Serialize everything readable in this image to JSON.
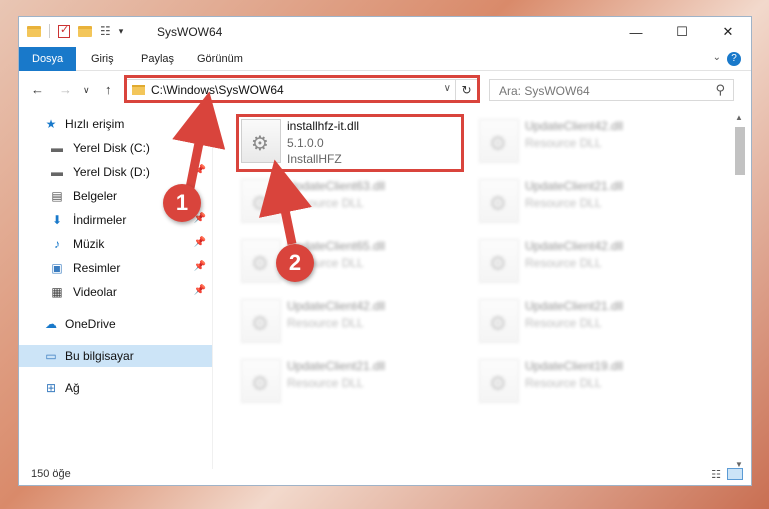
{
  "window": {
    "title": "SysWOW64",
    "controls": {
      "minimize": "—",
      "maximize": "☐",
      "close": "✕"
    }
  },
  "ribbon": {
    "tabs": [
      {
        "label": "Dosya",
        "active": true
      },
      {
        "label": "Giriş"
      },
      {
        "label": "Paylaş"
      },
      {
        "label": "Görünüm"
      }
    ],
    "help": "?"
  },
  "address": {
    "path": "C:\\Windows\\SysWOW64",
    "search_placeholder": "Ara: SysWOW64"
  },
  "sidebar": {
    "items": [
      {
        "label": "Hızlı erişim",
        "icon": "star-icon"
      },
      {
        "label": "Yerel Disk (C:)",
        "icon": "drive-icon"
      },
      {
        "label": "Yerel Disk (D:)",
        "icon": "drive-icon"
      },
      {
        "label": "Belgeler",
        "icon": "document-icon"
      },
      {
        "label": "İndirmeler",
        "icon": "download-icon"
      },
      {
        "label": "Müzik",
        "icon": "music-icon"
      },
      {
        "label": "Resimler",
        "icon": "picture-icon"
      },
      {
        "label": "Videolar",
        "icon": "video-icon"
      },
      {
        "label": "OneDrive",
        "icon": "cloud-icon"
      },
      {
        "label": "Bu bilgisayar",
        "icon": "computer-icon"
      },
      {
        "label": "Ağ",
        "icon": "network-icon"
      }
    ]
  },
  "files": [
    {
      "name": "installhfz-it.dll",
      "version": "5.1.0.0",
      "description": "InstallHFZ"
    },
    {
      "name": "UpdateClient42.dll",
      "description": "Resource DLL"
    },
    {
      "name": "UpdateClient63.dll",
      "description": "Resource DLL"
    },
    {
      "name": "UpdateClient21.dll",
      "description": "Resource DLL"
    },
    {
      "name": "UpdateClient65.dll",
      "description": "Resource DLL"
    },
    {
      "name": "UpdateClient42.dll",
      "description": "Resource DLL"
    },
    {
      "name": "UpdateClient42.dll",
      "description": "Resource DLL"
    },
    {
      "name": "UpdateClient21.dll",
      "description": "Resource DLL"
    },
    {
      "name": "UpdateClient21.dll",
      "description": "Resource DLL"
    },
    {
      "name": "UpdateClient19.dll",
      "description": "Resource DLL"
    }
  ],
  "status": {
    "count": "150 öğe"
  },
  "annotations": {
    "badge1": "1",
    "badge2": "2",
    "color": "#d9443c"
  }
}
